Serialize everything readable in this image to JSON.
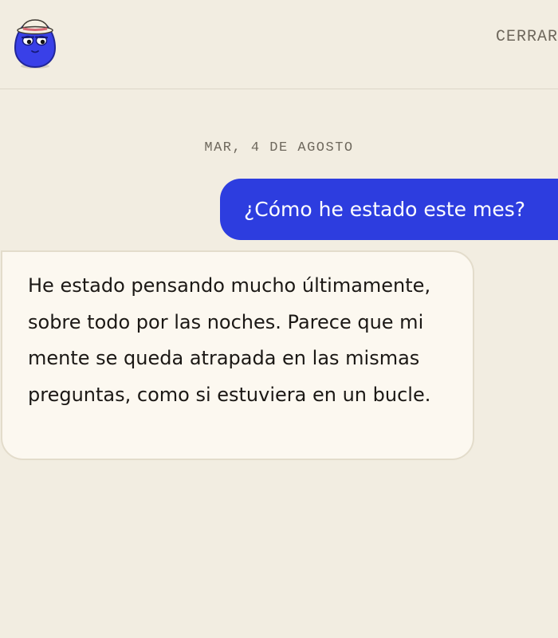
{
  "header": {
    "close_label": "CERRAR",
    "avatar_icon": "blue-egg-mascot-with-hat-icon"
  },
  "conversation": {
    "date": "MAR, 4 DE AGOSTO",
    "messages": [
      {
        "role": "user",
        "text": "¿Cómo he estado este mes?"
      },
      {
        "role": "assistant",
        "text": "He estado pensando mucho últimamente, sobre todo por las noches. Parece que mi mente se queda atrapada en las mismas preguntas, como si estuviera en un bucle."
      }
    ]
  },
  "colors": {
    "background": "#f2ede1",
    "user_bubble": "#2d3ddf",
    "assistant_bubble": "#fcf8f0",
    "assistant_border": "#e3dccb",
    "text_muted": "#6e685d"
  }
}
